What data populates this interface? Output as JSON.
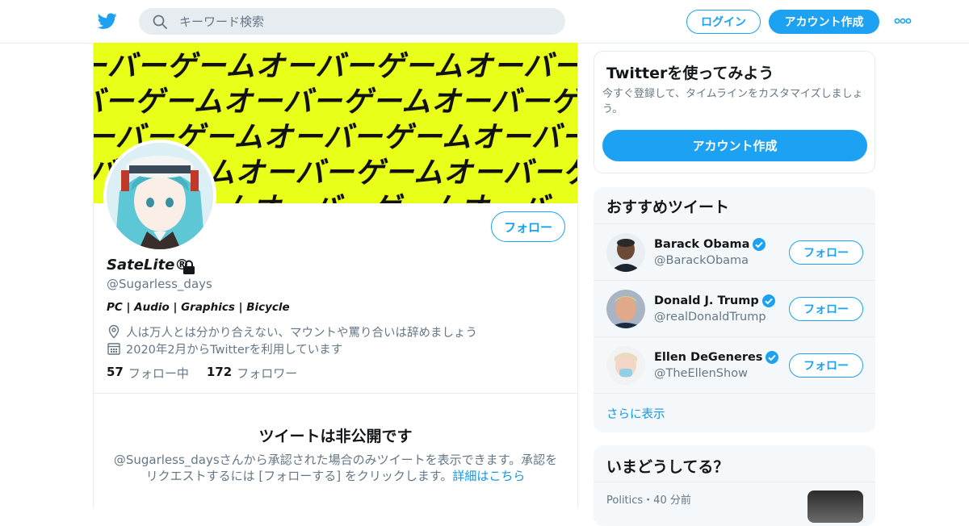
{
  "header": {
    "search_placeholder": "キーワード検索",
    "login_label": "ログイン",
    "signup_label": "アカウント作成"
  },
  "profile": {
    "banner_text": "ーバーゲームオーバーゲームオーバーゲーム",
    "display_name": "SateLite®",
    "handle": "@Sugarless_days",
    "bio": "PC | Audio | Graphics | Bicycle",
    "location": "人は万人とは分かり合えない、マウントや罵り合いは辞めましょう",
    "joined": "2020年2月からTwitterを利用しています",
    "following_count": "57",
    "following_label": "フォロー中",
    "followers_count": "172",
    "followers_label": "フォロワー",
    "follow_label": "フォロー",
    "private_title": "ツイートは非公開です",
    "private_desc": "@Sugarless_daysさんから承認された場合のみツイートを表示できます。承認をリクエストするには [フォローする] をクリックします。",
    "private_link": "詳細はこちら"
  },
  "signup_card": {
    "title": "Twitterを使ってみよう",
    "desc": "今すぐ登録して、タイムラインをカスタマイズしましょう。",
    "button": "アカウント作成"
  },
  "recommend": {
    "title": "おすすめツイート",
    "items": [
      {
        "name": "Barack Obama",
        "handle": "@BarackObama",
        "follow": "フォロー"
      },
      {
        "name": "Donald J. Trump",
        "handle": "@realDonaldTrump",
        "follow": "フォロー"
      },
      {
        "name": "Ellen DeGeneres",
        "handle": "@TheEllenShow",
        "follow": "フォロー"
      }
    ],
    "show_more": "さらに表示"
  },
  "trends": {
    "title": "いまどうしてる？",
    "item_meta": "Politics・40 分前"
  },
  "colors": {
    "accent": "#1da1f2",
    "banner": "#e8ff1a",
    "muted": "#657786"
  }
}
